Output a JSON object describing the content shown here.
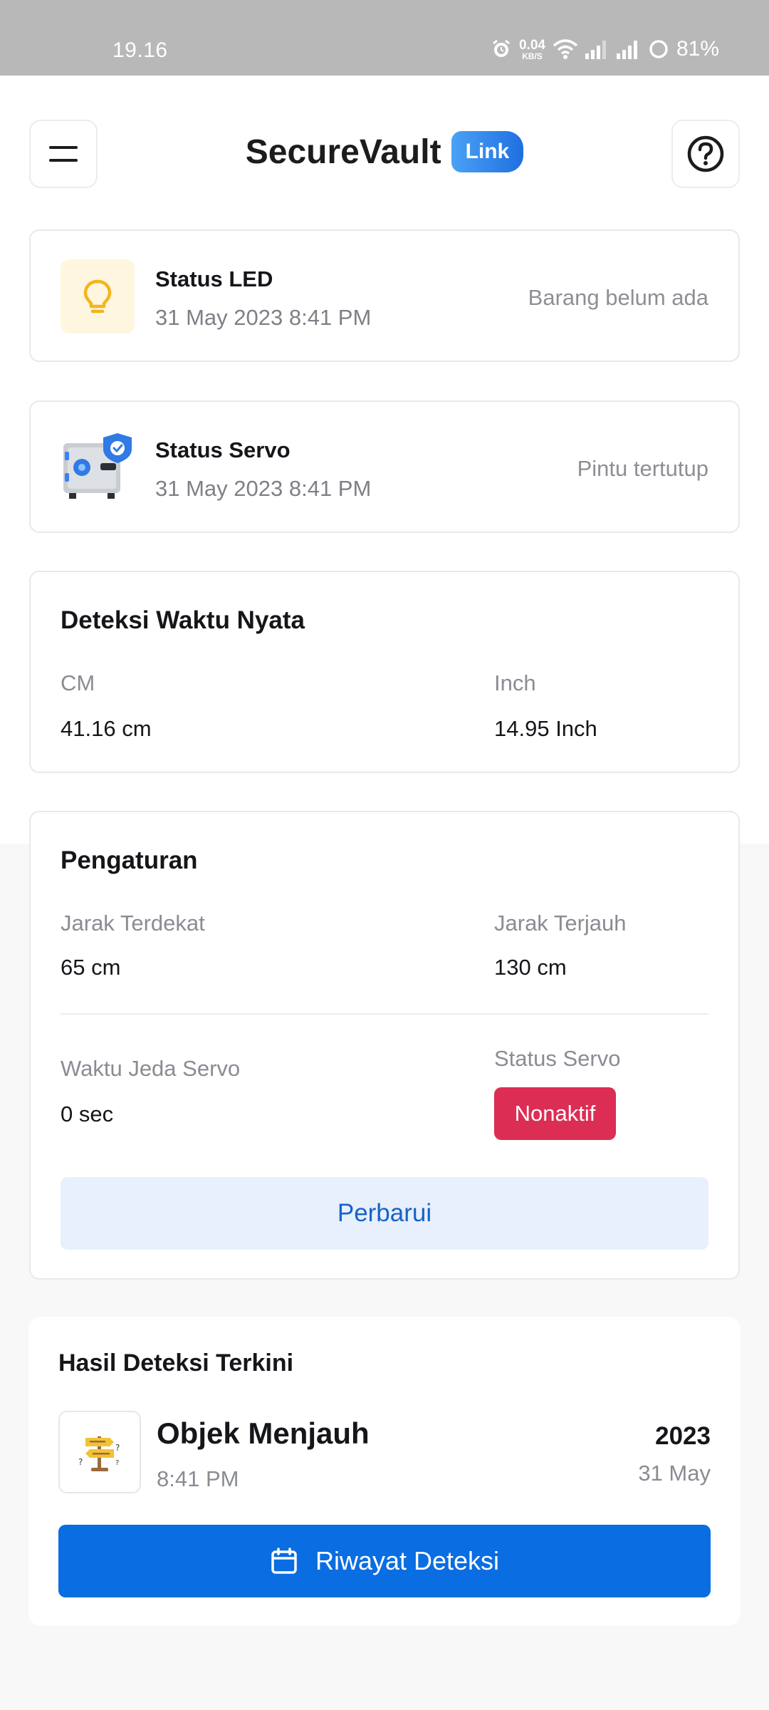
{
  "status_bar": {
    "time": "19.16",
    "speed_value": "0.04",
    "speed_unit": "KB/S",
    "battery": "81%"
  },
  "header": {
    "title": "SecureVault",
    "badge": "Link"
  },
  "led_card": {
    "title": "Status LED",
    "timestamp": "31 May 2023 8:41 PM",
    "value": "Barang belum ada"
  },
  "servo_card": {
    "title": "Status Servo",
    "timestamp": "31 May 2023 8:41 PM",
    "value": "Pintu tertutup"
  },
  "realtime": {
    "title": "Deteksi Waktu Nyata",
    "cm_label": "CM",
    "cm_value": "41.16 cm",
    "inch_label": "Inch",
    "inch_value": "14.95 Inch"
  },
  "settings": {
    "title": "Pengaturan",
    "min_label": "Jarak Terdekat",
    "min_value": "65 cm",
    "max_label": "Jarak Terjauh",
    "max_value": "130 cm",
    "delay_label": "Waktu Jeda Servo",
    "delay_value": "0 sec",
    "servo_label": "Status Servo",
    "servo_status": "Nonaktif",
    "update_button": "Perbarui"
  },
  "results": {
    "title": "Hasil Deteksi Terkini",
    "item_name": "Objek Menjauh",
    "item_time": "8:41 PM",
    "item_year": "2023",
    "item_date": "31 May",
    "history_button": "Riwayat Deteksi"
  },
  "colors": {
    "primary": "#0a6de2",
    "danger": "#dc2d55",
    "led_bg": "#fff6e0",
    "led_icon": "#f2b51c"
  },
  "icons": {
    "menu": "menu-icon",
    "help": "help-icon",
    "led": "lightbulb-icon",
    "servo": "safe-icon",
    "result": "signpost-icon",
    "history": "calendar-icon"
  }
}
